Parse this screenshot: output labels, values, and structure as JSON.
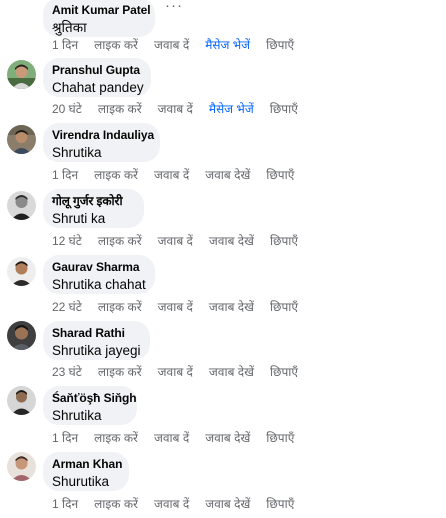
{
  "comments": [
    {
      "author": "Amit Kumar Patel",
      "text": "श्रुतिका",
      "time": "1 दिन",
      "like": "लाइक करें",
      "reply": "जवाब दें",
      "third": "मैसेज भेजें",
      "hide": "छिपाएँ",
      "third_kind": "message"
    },
    {
      "author": "Pranshul Gupta",
      "text": "Chahat pandey",
      "time": "20 घंटे",
      "like": "लाइक करें",
      "reply": "जवाब दें",
      "third": "मैसेज भेजें",
      "hide": "छिपाएँ",
      "third_kind": "message"
    },
    {
      "author": "Virendra Indauliya",
      "text": "Shrutika",
      "time": "1 दिन",
      "like": "लाइक करें",
      "reply": "जवाब दें",
      "third": "जवाब देखें",
      "hide": "छिपाएँ",
      "third_kind": "view"
    },
    {
      "author": "गोलू गुर्जर इकोरी",
      "text": "Shruti ka",
      "time": "12 घंटे",
      "like": "लाइक करें",
      "reply": "जवाब दें",
      "third": "जवाब देखें",
      "hide": "छिपाएँ",
      "third_kind": "view"
    },
    {
      "author": "Gaurav Sharma",
      "text": "Shrutika chahat",
      "time": "22 घंटे",
      "like": "लाइक करें",
      "reply": "जवाब दें",
      "third": "जवाब देखें",
      "hide": "छिपाएँ",
      "third_kind": "view"
    },
    {
      "author": "Sharad Rathi",
      "text": "Shrutika jayegi",
      "time": "23 घंटे",
      "like": "लाइक करें",
      "reply": "जवाब दें",
      "third": "जवाब देखें",
      "hide": "छिपाएँ",
      "third_kind": "view"
    },
    {
      "author": "Śaňťöşħ Siňgh",
      "text": "Shrutika",
      "time": "1 दिन",
      "like": "लाइक करें",
      "reply": "जवाब दें",
      "third": "जवाब देखें",
      "hide": "छिपाएँ",
      "third_kind": "view"
    },
    {
      "author": "Arman Khan",
      "text": "Shurutika",
      "time": "1 दिन",
      "like": "लाइक करें",
      "reply": "जवाब दें",
      "third": "जवाब देखें",
      "hide": "छिपाएँ",
      "third_kind": "view"
    }
  ],
  "more_options_icon": "ellipsis-icon",
  "colors": {
    "bubble": "#f0f2f5",
    "meta_text": "#65676b",
    "message_link": "#0866ff",
    "text": "#050505"
  }
}
